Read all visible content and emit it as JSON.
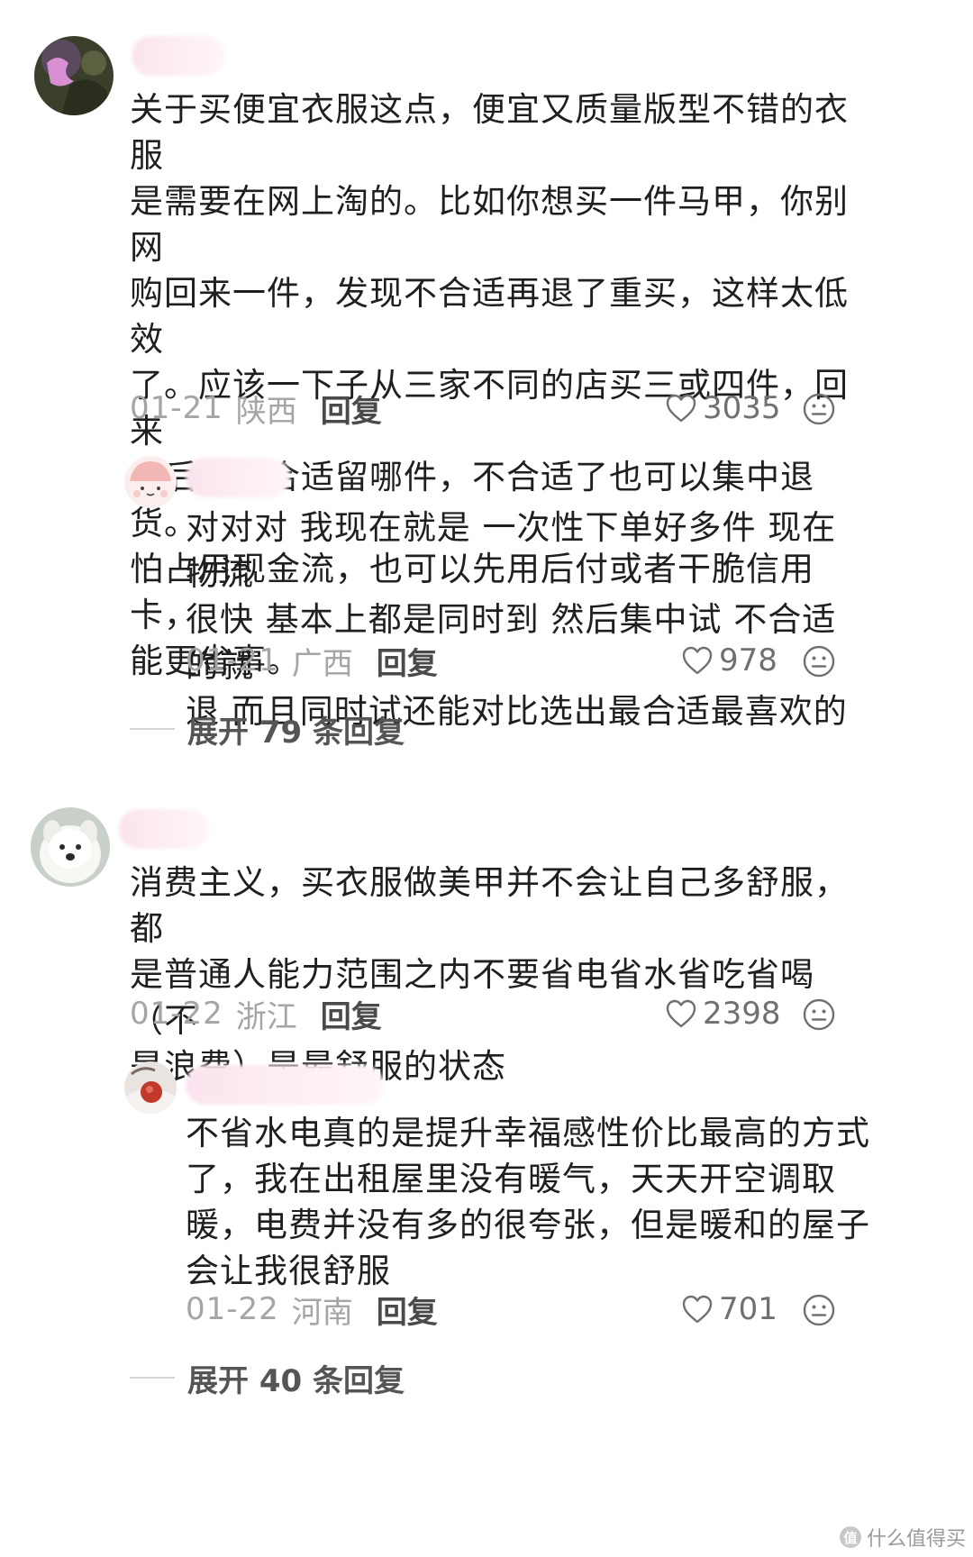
{
  "comments": [
    {
      "text": "关于买便宜衣服这点，便宜又质量版型不错的衣服\n是需要在网上淘的。比如你想买一件马甲，你别网\n购回来一件，发现不合适再退了重买，这样太低效\n了。应该一下子从三家不同的店买三或四件，回来\n以后哪件合适留哪件，不合适了也可以集中退货。\n怕占用现金流，也可以先用后付或者干脆信用卡，\n能更省事。",
      "date": "01-21",
      "region": "陕西",
      "reply_label": "回复",
      "likes": "3035",
      "reply": {
        "text": "对对对 我现在就是 一次性下单好多件 现在物流\n很快 基本上都是同时到 然后集中试 不合适的就\n退 而且同时试还能对比选出最合适最喜欢的",
        "date": "01-21",
        "region": "广西",
        "reply_label": "回复",
        "likes": "978"
      },
      "expand_label": "展开 79 条回复"
    },
    {
      "text": "消费主义，买衣服做美甲并不会让自己多舒服，都\n是普通人能力范围之内不要省电省水省吃省喝（不\n是浪费）是最舒服的状态",
      "date": "01-22",
      "region": "浙江",
      "reply_label": "回复",
      "likes": "2398",
      "reply": {
        "text": "不省水电真的是提升幸福感性价比最高的方式\n了，我在出租屋里没有暖气，天天开空调取\n暖，电费并没有多的很夸张，但是暖和的屋子\n会让我很舒服",
        "date": "01-22",
        "region": "河南",
        "reply_label": "回复",
        "likes": "701"
      },
      "expand_label": "展开 40 条回复"
    }
  ],
  "watermark": {
    "logo": "值",
    "text": "什么值得买"
  },
  "icons": {
    "heart": "heart-outline-icon",
    "emoji": "neutral-face-icon"
  },
  "colors": {
    "text": "#1f1f1f",
    "meta": "#a5a5a5",
    "reply_button": "#4a4a4a",
    "name_blur": "#fbe3ee"
  }
}
